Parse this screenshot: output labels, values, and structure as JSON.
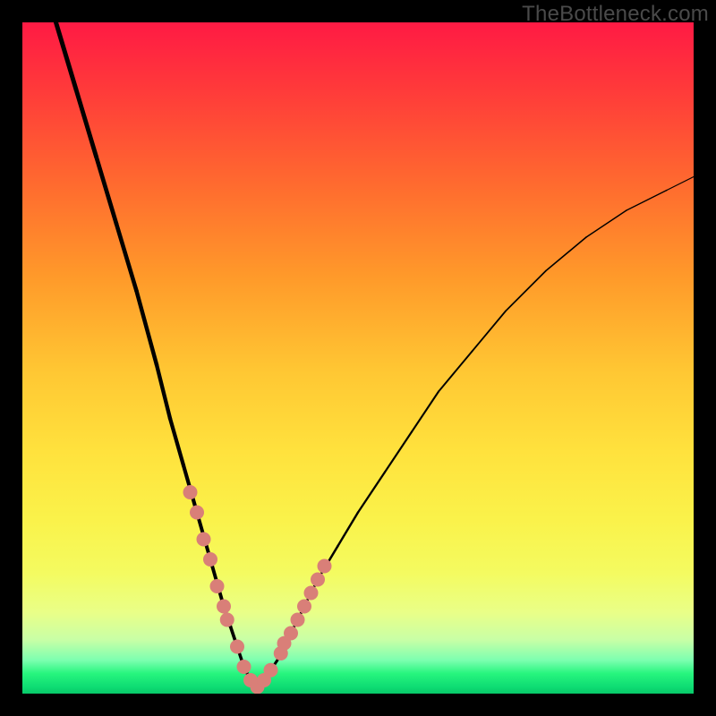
{
  "watermark": "TheBottleneck.com",
  "chart_data": {
    "type": "line",
    "title": "",
    "xlabel": "",
    "ylabel": "",
    "xlim": [
      0,
      100
    ],
    "ylim": [
      0,
      100
    ],
    "grid": false,
    "legend_position": "none",
    "series": [
      {
        "name": "bottleneck-curve",
        "x": [
          5,
          8,
          11,
          14,
          17,
          20,
          22,
          24,
          26,
          28,
          30,
          31,
          32,
          33,
          34,
          35,
          36,
          38,
          40,
          42,
          44,
          47,
          50,
          54,
          58,
          62,
          67,
          72,
          78,
          84,
          90,
          96,
          100
        ],
        "y": [
          100,
          90,
          80,
          70,
          60,
          49,
          41,
          34,
          27,
          20,
          13,
          10,
          7,
          4,
          2,
          1,
          2,
          5,
          9,
          13,
          17,
          22,
          27,
          33,
          39,
          45,
          51,
          57,
          63,
          68,
          72,
          75,
          77
        ]
      }
    ],
    "markers": {
      "name": "highlight-points",
      "x": [
        25,
        26,
        27,
        28,
        29,
        30,
        30.5,
        32,
        33,
        34,
        35,
        36,
        37,
        38.5,
        39,
        40,
        41,
        42,
        43,
        44,
        45
      ],
      "y": [
        30,
        27,
        23,
        20,
        16,
        13,
        11,
        7,
        4,
        2,
        1,
        2,
        3.5,
        6,
        7.5,
        9,
        11,
        13,
        15,
        17,
        19
      ],
      "color": "#d97f78",
      "radius": 8
    },
    "background_gradient": {
      "stops": [
        {
          "pos": 0.0,
          "color": "#ff1a44"
        },
        {
          "pos": 0.1,
          "color": "#ff3a3a"
        },
        {
          "pos": 0.24,
          "color": "#ff6a2f"
        },
        {
          "pos": 0.38,
          "color": "#ff9a2a"
        },
        {
          "pos": 0.52,
          "color": "#ffc733"
        },
        {
          "pos": 0.64,
          "color": "#ffe23d"
        },
        {
          "pos": 0.74,
          "color": "#faf24a"
        },
        {
          "pos": 0.82,
          "color": "#f4fb60"
        },
        {
          "pos": 0.88,
          "color": "#e9ff88"
        },
        {
          "pos": 0.92,
          "color": "#c8ffa6"
        },
        {
          "pos": 0.95,
          "color": "#7dffb0"
        },
        {
          "pos": 0.97,
          "color": "#27f57e"
        },
        {
          "pos": 0.99,
          "color": "#0edc73"
        },
        {
          "pos": 1.0,
          "color": "#08c969"
        }
      ]
    },
    "curve_stroke": "#000000",
    "curve_stroke_width_start": 5,
    "curve_stroke_width_end": 1.2
  }
}
